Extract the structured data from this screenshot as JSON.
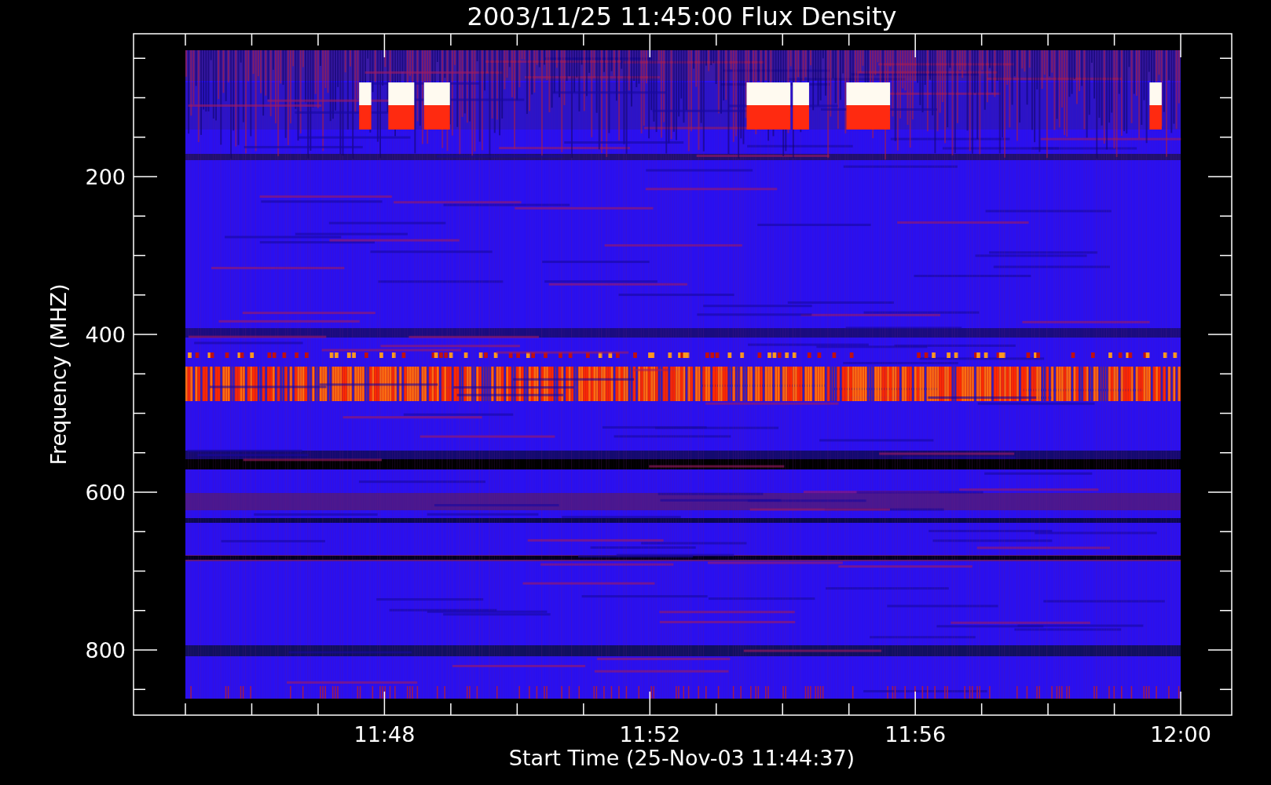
{
  "plot": {
    "title": "2003/11/25 11:45:00 Flux Density",
    "xlabel": "Start Time (25-Nov-03 11:44:37)",
    "ylabel": "Frequency (MHZ)",
    "xticks": [
      "11:48",
      "11:52",
      "11:56",
      "12:00"
    ],
    "yticks": [
      "200",
      "400",
      "600",
      "800"
    ]
  }
}
